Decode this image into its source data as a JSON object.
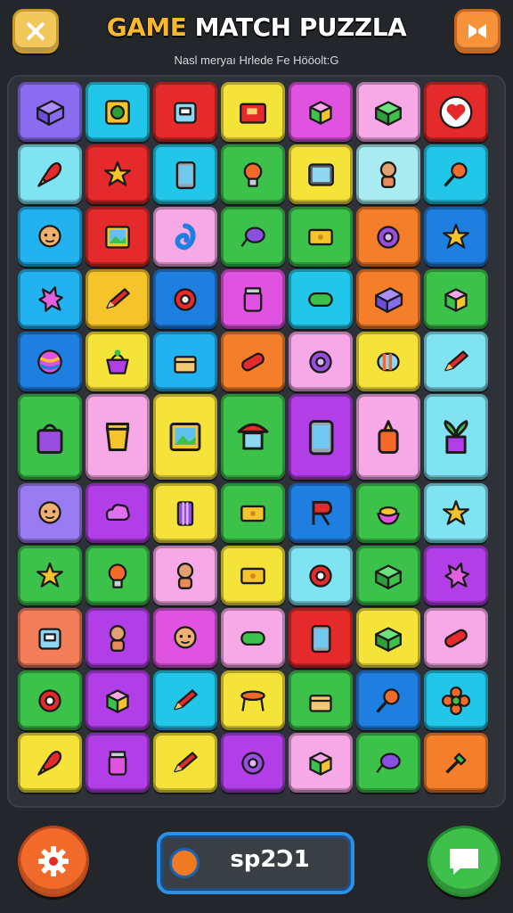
{
  "header": {
    "title_word_1": "GAME",
    "title_rest": " MATCH PUZZLA",
    "subtitle": "Nasl meryaı Hrlede Fe Hööolt:G",
    "close_button_icon": "close-icon",
    "action_button_icon": "bowtie-icon"
  },
  "board": {
    "rows": 11,
    "cols": 7,
    "tiles": [
      [
        {
          "color": "#8a6cf0",
          "icon": "purple-box-icon"
        },
        {
          "color": "#22c6e8",
          "icon": "map-icon"
        },
        {
          "color": "#e42a2a",
          "icon": "robot-icon"
        },
        {
          "color": "#f5e33a",
          "icon": "red-box-icon"
        },
        {
          "color": "#e052e0",
          "icon": "cube-icon"
        },
        {
          "color": "#f7a8e6",
          "icon": "green-box-icon"
        },
        {
          "color": "#e42a2a",
          "icon": "heart-icon"
        }
      ],
      [
        {
          "color": "#7fe3f2",
          "icon": "rocket-icon"
        },
        {
          "color": "#e42a2a",
          "icon": "star-icon"
        },
        {
          "color": "#22c6e8",
          "icon": "phone-icon"
        },
        {
          "color": "#3cc24a",
          "icon": "bulb-icon"
        },
        {
          "color": "#f5e33a",
          "icon": "tablet-icon"
        },
        {
          "color": "#a8ecf2",
          "icon": "doll-icon"
        },
        {
          "color": "#22c6e8",
          "icon": "lollipop-icon"
        }
      ],
      [
        {
          "color": "#22b2f0",
          "icon": "face-icon"
        },
        {
          "color": "#e42a2a",
          "icon": "picture-icon"
        },
        {
          "color": "#f7a8e6",
          "icon": "swirl-icon"
        },
        {
          "color": "#3cc24a",
          "icon": "balloon-icon"
        },
        {
          "color": "#3cc24a",
          "icon": "ticket-icon"
        },
        {
          "color": "#f57e2a",
          "icon": "gear-icon"
        },
        {
          "color": "#1f7fe0",
          "icon": "star-icon"
        }
      ],
      [
        {
          "color": "#22b2f0",
          "icon": "splash-icon"
        },
        {
          "color": "#f5c42a",
          "icon": "crayon-icon"
        },
        {
          "color": "#1f7fe0",
          "icon": "ring-icon"
        },
        {
          "color": "#e052e0",
          "icon": "jar-icon"
        },
        {
          "color": "#22c6e8",
          "icon": "capsule-icon"
        },
        {
          "color": "#f57e2a",
          "icon": "purple-box-icon"
        },
        {
          "color": "#3cc24a",
          "icon": "cube-icon"
        }
      ],
      [
        {
          "color": "#1f7fe0",
          "icon": "ball-icon"
        },
        {
          "color": "#f5e33a",
          "icon": "basket-icon"
        },
        {
          "color": "#22b2f0",
          "icon": "chest-icon"
        },
        {
          "color": "#f57e2a",
          "icon": "tube-icon"
        },
        {
          "color": "#f7a8e6",
          "icon": "gear-icon"
        },
        {
          "color": "#f5e33a",
          "icon": "candy-icon"
        },
        {
          "color": "#7fe3f2",
          "icon": "crayon-icon"
        }
      ],
      [
        {
          "color": "#3cc24a",
          "icon": "bag-icon"
        },
        {
          "color": "#f7a8e6",
          "icon": "cup-icon"
        },
        {
          "color": "#f5e33a",
          "icon": "picture-icon"
        },
        {
          "color": "#3cc24a",
          "icon": "umbrella-icon"
        },
        {
          "color": "#b23ee8",
          "icon": "phone-icon"
        },
        {
          "color": "#f7a8e6",
          "icon": "bottle-icon"
        },
        {
          "color": "#7fe3f2",
          "icon": "plant-icon"
        }
      ],
      [
        {
          "color": "#9a7cf2",
          "icon": "face-icon"
        },
        {
          "color": "#b23ee8",
          "icon": "cloud-icon"
        },
        {
          "color": "#f5e33a",
          "icon": "pillar-icon"
        },
        {
          "color": "#3cc24a",
          "icon": "ticket-icon"
        },
        {
          "color": "#1f7fe0",
          "icon": "letter-r-icon"
        },
        {
          "color": "#3cc24a",
          "icon": "bowl-icon"
        },
        {
          "color": "#7fe3f2",
          "icon": "star-icon"
        }
      ],
      [
        {
          "color": "#3cc24a",
          "icon": "star-icon"
        },
        {
          "color": "#3cc24a",
          "icon": "bulb-icon"
        },
        {
          "color": "#f7a8e6",
          "icon": "doll-icon"
        },
        {
          "color": "#f5e33a",
          "icon": "ticket-icon"
        },
        {
          "color": "#7fe3f2",
          "icon": "ring-icon"
        },
        {
          "color": "#3cc24a",
          "icon": "green-box-icon"
        },
        {
          "color": "#b23ee8",
          "icon": "splash-icon"
        }
      ],
      [
        {
          "color": "#f57e5a",
          "icon": "robot-icon"
        },
        {
          "color": "#b23ee8",
          "icon": "doll-icon"
        },
        {
          "color": "#e052e0",
          "icon": "face-icon"
        },
        {
          "color": "#f7a8e6",
          "icon": "capsule-icon"
        },
        {
          "color": "#e42a2a",
          "icon": "phone-icon"
        },
        {
          "color": "#f5e33a",
          "icon": "green-box-icon"
        },
        {
          "color": "#f7a8e6",
          "icon": "tube-icon"
        }
      ],
      [
        {
          "color": "#3cc24a",
          "icon": "ring-icon"
        },
        {
          "color": "#b23ee8",
          "icon": "cube-icon"
        },
        {
          "color": "#22c6e8",
          "icon": "crayon-icon"
        },
        {
          "color": "#f5e33a",
          "icon": "table-icon"
        },
        {
          "color": "#3cc24a",
          "icon": "chest-icon"
        },
        {
          "color": "#1f7fe0",
          "icon": "lollipop-icon"
        },
        {
          "color": "#22c6e8",
          "icon": "flower-icon"
        }
      ],
      [
        {
          "color": "#f5e33a",
          "icon": "rocket-icon"
        },
        {
          "color": "#b23ee8",
          "icon": "jar-icon"
        },
        {
          "color": "#f5e33a",
          "icon": "crayon-icon"
        },
        {
          "color": "#b23ee8",
          "icon": "gear-icon"
        },
        {
          "color": "#f7a8e6",
          "icon": "cube-icon"
        },
        {
          "color": "#3cc24a",
          "icon": "balloon-icon"
        },
        {
          "color": "#f57e2a",
          "icon": "brush-icon"
        }
      ]
    ]
  },
  "footer": {
    "settings_icon": "gear-icon",
    "score": "sp2Ɔ1",
    "chat_icon": "chat-icon"
  }
}
